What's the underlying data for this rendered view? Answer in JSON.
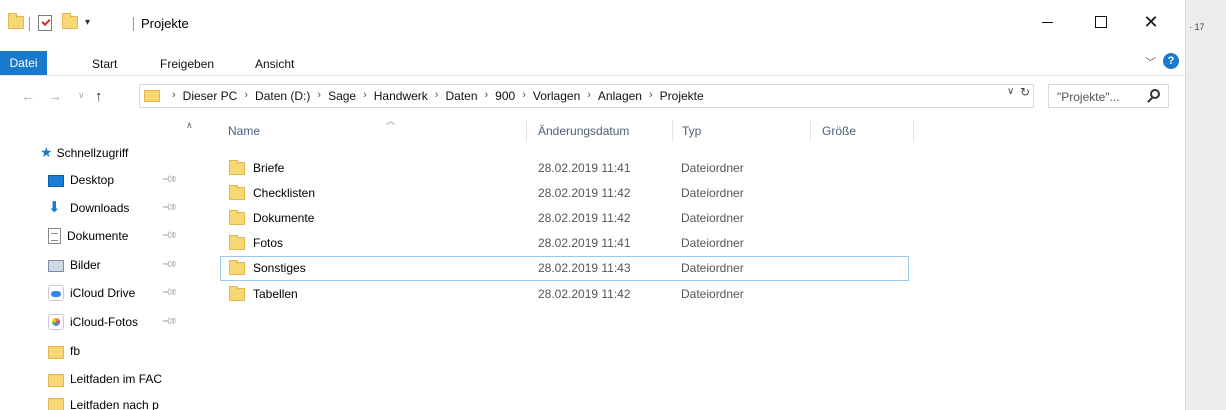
{
  "window": {
    "title": "Projekte",
    "right_strip_text": "· 17"
  },
  "ribbon": {
    "tabs": [
      "Datei",
      "Start",
      "Freigeben",
      "Ansicht"
    ],
    "help": "?"
  },
  "address": {
    "crumbs": [
      "Dieser PC",
      "Daten (D:)",
      "Sage",
      "Handwerk",
      "Daten",
      "900",
      "Vorlagen",
      "Anlagen",
      "Projekte"
    ],
    "search_placeholder": "\"Projekte\"..."
  },
  "navpane": {
    "quick_access": "Schnellzugriff",
    "items": [
      {
        "label": "Desktop",
        "icon": "desktop-icon",
        "pinned": true
      },
      {
        "label": "Downloads",
        "icon": "download-icon",
        "pinned": true
      },
      {
        "label": "Dokumente",
        "icon": "document-icon",
        "pinned": true
      },
      {
        "label": "Bilder",
        "icon": "pictures-icon",
        "pinned": true
      },
      {
        "label": "iCloud Drive",
        "icon": "icloud-drive-icon",
        "pinned": true
      },
      {
        "label": "iCloud-Fotos",
        "icon": "icloud-photos-icon",
        "pinned": true
      },
      {
        "label": "fb",
        "icon": "folder-icon",
        "pinned": false
      },
      {
        "label": "Leitfaden im FAC",
        "icon": "folder-icon",
        "pinned": false
      },
      {
        "label": "Leitfaden nach p",
        "icon": "folder-icon",
        "pinned": false
      }
    ]
  },
  "columns": {
    "name": "Name",
    "date": "Änderungsdatum",
    "type": "Typ",
    "size": "Größe"
  },
  "files": [
    {
      "name": "Briefe",
      "date": "28.02.2019 11:41",
      "type": "Dateiordner",
      "selected": false
    },
    {
      "name": "Checklisten",
      "date": "28.02.2019 11:42",
      "type": "Dateiordner",
      "selected": false
    },
    {
      "name": "Dokumente",
      "date": "28.02.2019 11:42",
      "type": "Dateiordner",
      "selected": false
    },
    {
      "name": "Fotos",
      "date": "28.02.2019 11:41",
      "type": "Dateiordner",
      "selected": false
    },
    {
      "name": "Sonstiges",
      "date": "28.02.2019 11:43",
      "type": "Dateiordner",
      "selected": true
    },
    {
      "name": "Tabellen",
      "date": "28.02.2019 11:42",
      "type": "Dateiordner",
      "selected": false
    }
  ],
  "colors": {
    "accent": "#1979ca",
    "folder": "#f8d775",
    "selection_border": "#99c9ef",
    "header_text": "#4c607a"
  }
}
